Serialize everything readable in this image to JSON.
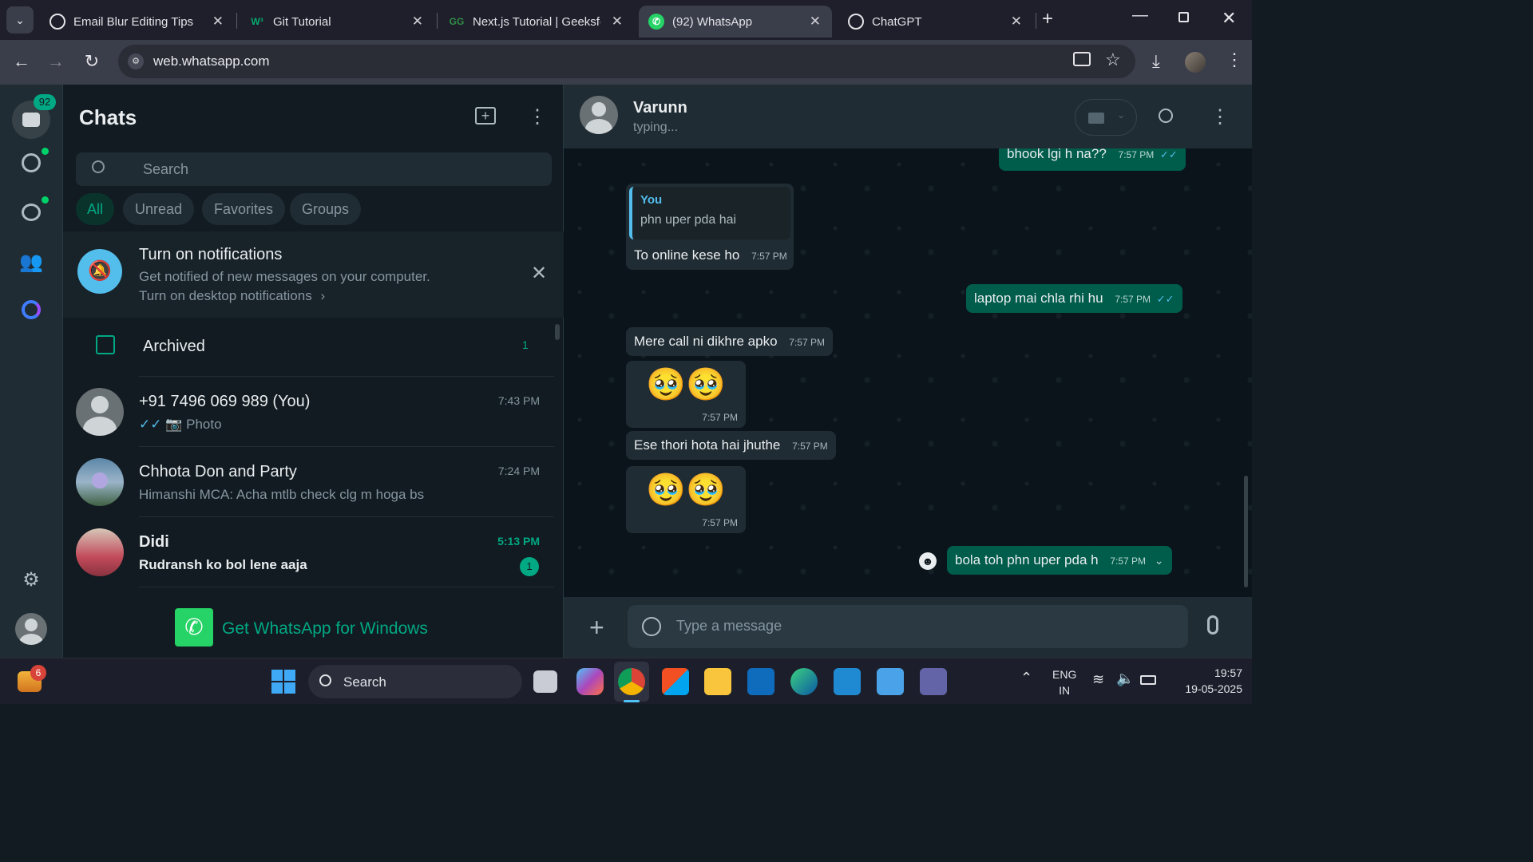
{
  "browser": {
    "tabs": [
      {
        "label": "Email Blur Editing Tips",
        "icon": "openai-icon"
      },
      {
        "label": "Git Tutorial",
        "icon": "w3-icon"
      },
      {
        "label": "Next.js Tutorial | Geeksfo",
        "icon": "gfg-icon"
      },
      {
        "label": "(92) WhatsApp",
        "icon": "whatsapp-icon",
        "active": true
      },
      {
        "label": "ChatGPT",
        "icon": "openai-icon"
      }
    ],
    "url": "web.whatsapp.com"
  },
  "rail": {
    "chats_badge": "92"
  },
  "chatlist": {
    "title": "Chats",
    "search_placeholder": "Search",
    "filters": [
      "All",
      "Unread",
      "Favorites",
      "Groups"
    ],
    "notification": {
      "title": "Turn on notifications",
      "subtitle": "Get notified of new messages on your computer.",
      "link": "Turn on desktop notifications"
    },
    "archived": {
      "label": "Archived",
      "count": "1"
    },
    "chats": [
      {
        "name": "+91 7496 069 989 (You)",
        "preview": "Photo",
        "time": "7:43 PM"
      },
      {
        "name": "Chhota Don and Party",
        "preview": "Himanshi MCA: Acha mtlb check clg m hoga bs",
        "time": "7:24 PM"
      },
      {
        "name": "Didi",
        "preview": "Rudransh ko bol lene aaja",
        "time": "5:13 PM",
        "unread": "1"
      }
    ],
    "get_app": "Get WhatsApp for Windows"
  },
  "conversation": {
    "contact_name": "Varunn",
    "status": "typing...",
    "messages": [
      {
        "dir": "out",
        "text": "bhook lgi h na??",
        "time": "7:57 PM"
      },
      {
        "dir": "in",
        "quote_author": "You",
        "quote_text": "phn uper pda hai",
        "text": "To online kese ho",
        "time": "7:57 PM"
      },
      {
        "dir": "out",
        "text": "laptop mai chla rhi hu",
        "time": "7:57 PM"
      },
      {
        "dir": "in",
        "text": "Mere call ni dikhre apko",
        "time": "7:57 PM"
      },
      {
        "dir": "in",
        "emoji": "🥹🥹",
        "time": "7:57 PM"
      },
      {
        "dir": "in",
        "text": "Ese thori hota hai jhuthe",
        "time": "7:57 PM"
      },
      {
        "dir": "in",
        "emoji": "🥹🥹",
        "time": "7:57 PM"
      },
      {
        "dir": "out",
        "text": "bola toh phn  uper pda h",
        "time": "7:57 PM"
      }
    ],
    "composer_placeholder": "Type a message"
  },
  "taskbar": {
    "search_placeholder": "Search",
    "weather_badge": "6",
    "language": "ENG",
    "region": "IN",
    "time": "19:57",
    "date": "19-05-2025"
  },
  "colors": {
    "accent": "#00a884",
    "bubble_out": "#005c4b",
    "bubble_in": "#202c33",
    "panel": "#111b21"
  }
}
